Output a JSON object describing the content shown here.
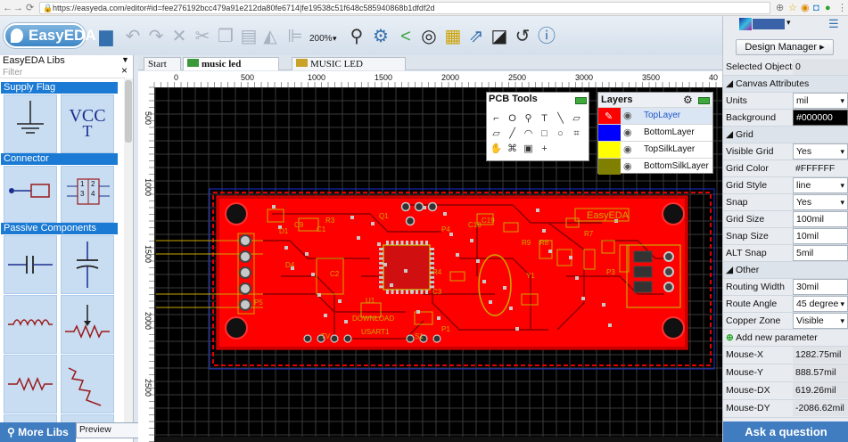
{
  "browser": {
    "url": "https://easyeda.com/editor#id=fee276192bcc479a91e212da80fe6714|fe19538c51f648c585940868b1dfdf2d",
    "nav_icons": [
      "back-arrow-icon",
      "forward-arrow-icon",
      "reload-icon",
      "lock-icon"
    ]
  },
  "app": {
    "logo_text": "EasyEDA",
    "zoom_level": "200%",
    "accent_color": "#3f7cc0"
  },
  "library": {
    "title": "EasyEDA Libs",
    "filter_placeholder": "Filter",
    "close_glyph": "×",
    "dropdown_glyph": "▼",
    "sections": [
      {
        "label": "Supply Flag"
      },
      {
        "label": "Connector"
      },
      {
        "label": "Passive Components"
      }
    ],
    "vcc_label": "VCC",
    "vcc_sub": "T",
    "header_pin_labels": [
      "1",
      "3",
      "2",
      "4"
    ],
    "more_libs_label": "More Libs",
    "preview_label": "Preview"
  },
  "tabs": [
    {
      "label": "Start"
    },
    {
      "label": "music led"
    },
    {
      "label": "MUSIC LED"
    }
  ],
  "ruler": {
    "x_ticks": [
      "0",
      "500",
      "1000",
      "1500",
      "2000",
      "2500",
      "3000",
      "3500",
      "40"
    ],
    "y_ticks": [
      "500",
      "1000",
      "1500",
      "2000",
      "2500"
    ]
  },
  "pcb_tools": {
    "title": "PCB Tools"
  },
  "layers": {
    "title": "Layers",
    "items": [
      {
        "name": "TopLayer",
        "color": "#ff0000"
      },
      {
        "name": "BottomLayer",
        "color": "#0000ff"
      },
      {
        "name": "TopSilkLayer",
        "color": "#ffff00"
      },
      {
        "name": "BottomSilkLayer",
        "color": "#808000"
      }
    ]
  },
  "board": {
    "brand": "EasyEDA",
    "texts": [
      "DOWNLOAD",
      "USART1",
      "R4",
      "U1",
      "P4",
      "C18",
      "C19",
      "R7",
      "R8",
      "R9",
      "P3",
      "P5",
      "D1",
      "Y1",
      "Q1",
      "C1",
      "C2",
      "C3",
      "C9",
      "D4",
      "TV",
      "S1",
      "P1",
      "R3"
    ]
  },
  "properties": {
    "design_manager": "Design Manager ▸",
    "selected_objects_label": "Selected Objects",
    "selected_objects_value": "0",
    "canvas_section": "Canvas Attributes",
    "units_label": "Units",
    "units_value": "mil",
    "background_label": "Background",
    "background_value": "#000000",
    "grid_section": "Grid",
    "visible_grid_label": "Visible Grid",
    "visible_grid_value": "Yes",
    "grid_color_label": "Grid Color",
    "grid_color_value": "#FFFFFF",
    "grid_style_label": "Grid Style",
    "grid_style_value": "line",
    "snap_label": "Snap",
    "snap_value": "Yes",
    "grid_size_label": "Grid Size",
    "grid_size_value": "100mil",
    "snap_size_label": "Snap Size",
    "snap_size_value": "10mil",
    "alt_snap_label": "ALT Snap",
    "alt_snap_value": "5mil",
    "other_section": "Other",
    "routing_width_label": "Routing Width",
    "routing_width_value": "30mil",
    "route_angle_label": "Route Angle",
    "route_angle_value": "45 degree",
    "copper_zone_label": "Copper Zone",
    "copper_zone_value": "Visible",
    "add_param_label": "Add new parameter",
    "mouse_x_label": "Mouse-X",
    "mouse_x_value": "1282.75mil",
    "mouse_y_label": "Mouse-Y",
    "mouse_y_value": "888.57mil",
    "mouse_dx_label": "Mouse-DX",
    "mouse_dx_value": "619.26mil",
    "mouse_dy_label": "Mouse-DY",
    "mouse_dy_value": "-2086.62mil",
    "ask_label": "Ask a question"
  }
}
